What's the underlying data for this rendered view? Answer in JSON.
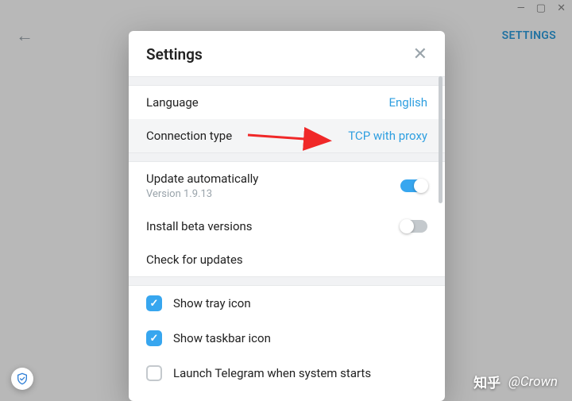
{
  "window_controls": {
    "min": "—",
    "max": "▢",
    "close": "✕"
  },
  "appbar": {
    "back_glyph": "←",
    "settings_link": "SETTINGS"
  },
  "modal": {
    "title": "Settings",
    "close_glyph": "✕",
    "rows": {
      "language": {
        "label": "Language",
        "value": "English"
      },
      "connection": {
        "label": "Connection type",
        "value": "TCP with proxy"
      },
      "update_auto": {
        "label": "Update automatically",
        "version": "Version 1.9.13",
        "on": true
      },
      "install_beta": {
        "label": "Install beta versions",
        "on": false
      },
      "check_updates": {
        "label": "Check for updates"
      },
      "tray_icon": {
        "label": "Show tray icon",
        "checked": true
      },
      "taskbar_icon": {
        "label": "Show taskbar icon",
        "checked": true
      },
      "launch_start": {
        "label": "Launch Telegram when system starts",
        "checked": false
      }
    }
  },
  "annotation": {
    "arrow_color": "#f02828"
  },
  "watermark": {
    "site": "知乎",
    "user": "@Crown"
  }
}
